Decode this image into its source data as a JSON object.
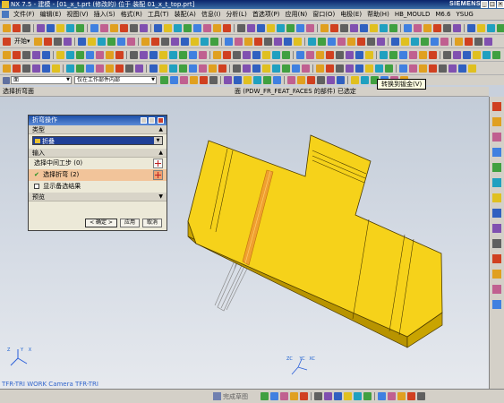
{
  "window": {
    "title": "NX 7.5 - 建模 - [01_x_t.prt (修改的) 位于 装配 01_x_t_top.prt]",
    "brand": "SIEMENS",
    "buttons": [
      "_",
      "□",
      "×"
    ]
  },
  "menubar": {
    "items": [
      "文件(F)",
      "编辑(E)",
      "视图(V)",
      "插入(S)",
      "格式(R)",
      "工具(T)",
      "装配(A)",
      "信息(I)",
      "分析(L)",
      "首选项(P)",
      "应用(N)",
      "窗口(O)",
      "电极(E)",
      "帮助(H)",
      "HB_MOULD",
      "M6.6",
      "YSUG"
    ],
    "brand": "SIEMENS"
  },
  "toolbar2": {
    "start_label": "开始▾"
  },
  "selection_bar": {
    "filter": "面",
    "scope": "仅在工作部件内部"
  },
  "tooltip": {
    "text": "转换到钣金(V)"
  },
  "cue": {
    "left": "选择折弯面",
    "right": "面 (PDW_FR_FEAT_FACES 的部件) 已选定"
  },
  "dialog": {
    "title": "折弯操作",
    "type_section": "类型",
    "type_value": "折叠",
    "input_section": "输入",
    "row1": "选择中间工步 (0)",
    "row2": "选择折弯 (2)",
    "row3": "显示备选结果",
    "preview_section": "预览",
    "ok": "< 确定 >",
    "apply": "应用",
    "cancel": "取消"
  },
  "viewport": {
    "csys_label": "TFR-TRI WORK Camera TFR-TRI",
    "axis_x": "X",
    "axis_y": "Y",
    "axis_z": "Z",
    "axis_xc": "XC",
    "axis_yc": "YC",
    "axis_zc": "ZC"
  },
  "statusbar": {
    "label": "完成草图"
  },
  "colors": {
    "part_face": "#f6d21a",
    "part_side": "#c9a400",
    "part_edge": "#4a3a00",
    "selection_highlight": "#f0a030",
    "titlebar": "#0a246a"
  }
}
